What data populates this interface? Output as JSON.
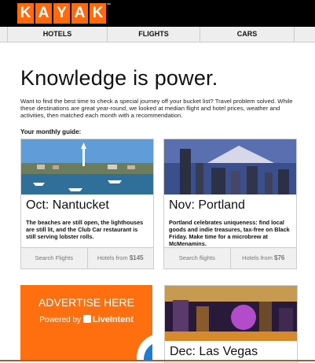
{
  "logo": {
    "letters": [
      "K",
      "A",
      "Y",
      "A",
      "K"
    ],
    "tm": "™"
  },
  "nav": {
    "tabs": [
      "HOTELS",
      "FLIGHTS",
      "CARS"
    ]
  },
  "hero": {
    "title": "Knowledge is power.",
    "intro": "Want to find the best time to check a special journey off your bucket list? Travel problem solved. While these destinations are great year-round, we looked at median flight and hotel prices, weather and activities, then matched each month with a recommendation.",
    "guide": "Your monthly guide:"
  },
  "cards": [
    {
      "title": "Oct: Nantucket",
      "desc": "The beaches are still open, the lighthouses are still lit, and the Club Car restaurant is still serving lobster rolls.",
      "search": "Search Flights",
      "hotels_prefix": "Hotels from ",
      "hotels_price": "$145"
    },
    {
      "title": "Nov: Portland",
      "desc": "Portland celebrates uniqueness: find local goods and indie treasures, tax-free on Black Friday. Make time for a microbrew at McMenamins.",
      "search": "Search flights",
      "hotels_prefix": "Hotels from ",
      "hotels_price": "$76"
    }
  ],
  "ad": {
    "headline": "ADVERTISE HERE",
    "powered_prefix": "Powered by ",
    "powered_brand": "LiveIntent"
  },
  "card3": {
    "title": "Dec: Las Vegas"
  },
  "colors": {
    "brand": "#ff690f",
    "ad": "#ff6f10"
  }
}
